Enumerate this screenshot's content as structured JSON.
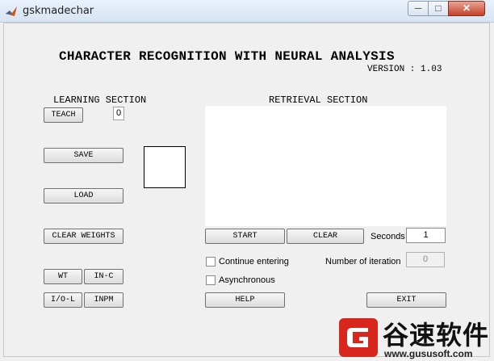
{
  "window": {
    "title": "gskmadechar"
  },
  "header": {
    "heading": "CHARACTER RECOGNITION WITH NEURAL ANALYSIS",
    "version": "VERSION : 1.03"
  },
  "learning": {
    "label": "LEARNING SECTION",
    "teach": "TEACH",
    "teach_count": "0",
    "save": "SAVE",
    "load": "LOAD",
    "clear_weights": "CLEAR WEIGHTS",
    "wt": "WT",
    "in_c": "IN-C",
    "i_o_l": "I/O-L",
    "inpm": "INPM"
  },
  "retrieval": {
    "label": "RETRIEVAL SECTION",
    "start": "START",
    "clear": "CLEAR",
    "seconds_label": "Seconds",
    "seconds_value": "1",
    "continue_entering": "Continue entering",
    "asynchronous": "Asynchronous",
    "iterations_label": "Number of iteration",
    "iterations_value": "0",
    "help": "HELP",
    "exit": "EXIT"
  },
  "watermark": {
    "cn_text": "谷速软件",
    "url": "www.gususoft.com"
  },
  "colors": {
    "accent_red": "#d9261c",
    "window_bg": "#f0f0f0"
  },
  "icons": [
    "matlab-icon",
    "minimize-icon",
    "maximize-icon",
    "close-icon"
  ]
}
